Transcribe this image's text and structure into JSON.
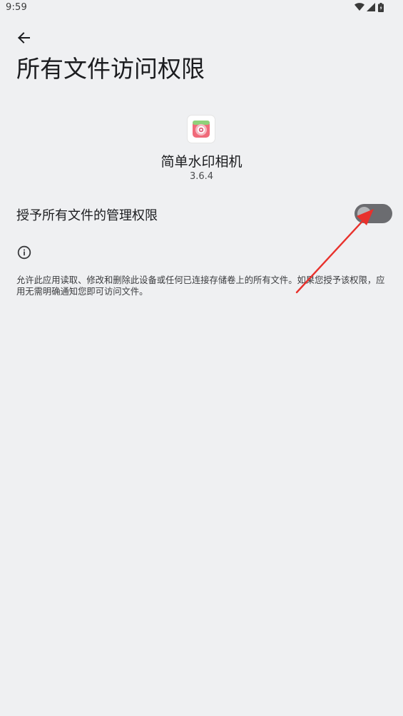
{
  "status_bar": {
    "time": "9:59",
    "icons": [
      "wifi-icon",
      "cellular-signal-icon",
      "battery-icon"
    ]
  },
  "header": {
    "back_icon": "arrow-left-icon",
    "title": "所有文件访问权限"
  },
  "app": {
    "icon": "camera-app-icon",
    "name": "简单水印相机",
    "version": "3.6.4"
  },
  "permission": {
    "label": "授予所有文件的管理权限",
    "enabled": false
  },
  "info": {
    "icon": "info-icon",
    "text": "允许此应用读取、修改和删除此设备或任何已连接存储卷上的所有文件。如果您授予该权限，应用无需明确通知您即可访问文件。"
  },
  "annotation": {
    "color": "#e8312c"
  },
  "colors": {
    "background": "#eff0f2",
    "toggle_track_off": "#6b6c70",
    "toggle_thumb_off": "#b4b5b8"
  }
}
